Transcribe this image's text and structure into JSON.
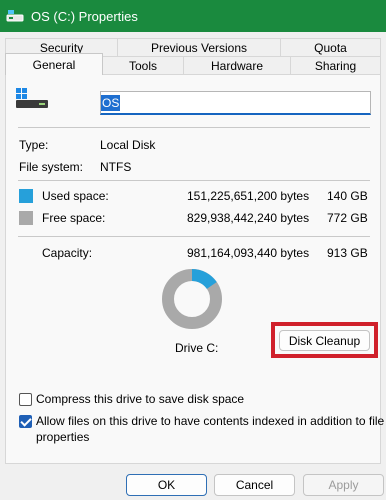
{
  "window": {
    "title": "OS (C:) Properties"
  },
  "tabs": {
    "row1": [
      "Security",
      "Previous Versions",
      "Quota"
    ],
    "row2": [
      "General",
      "Tools",
      "Hardware",
      "Sharing"
    ],
    "active": "General"
  },
  "general": {
    "name_value": "OS",
    "type_label": "Type:",
    "type_value": "Local Disk",
    "fs_label": "File system:",
    "fs_value": "NTFS",
    "used_label": "Used space:",
    "used_bytes": "151,225,651,200 bytes",
    "used_size": "140 GB",
    "free_label": "Free space:",
    "free_bytes": "829,938,442,240 bytes",
    "free_size": "772 GB",
    "capacity_label": "Capacity:",
    "capacity_bytes": "981,164,093,440 bytes",
    "capacity_size": "913 GB",
    "drive_label": "Drive C:",
    "disk_cleanup_label": "Disk Cleanup",
    "used_fraction": 0.154,
    "used_color": "#26a0da",
    "free_color": "#a9a9a9",
    "compress_label": "Compress this drive to save disk space",
    "compress_checked": false,
    "index_label_line1": "Allow files on this drive to have contents indexed in addition to file",
    "index_label_line2": "properties",
    "index_checked": true
  },
  "buttons": {
    "ok": "OK",
    "cancel": "Cancel",
    "apply": "Apply"
  },
  "icons": {
    "title_icon": "drive-icon",
    "drive_icon": "windows-drive-icon"
  }
}
